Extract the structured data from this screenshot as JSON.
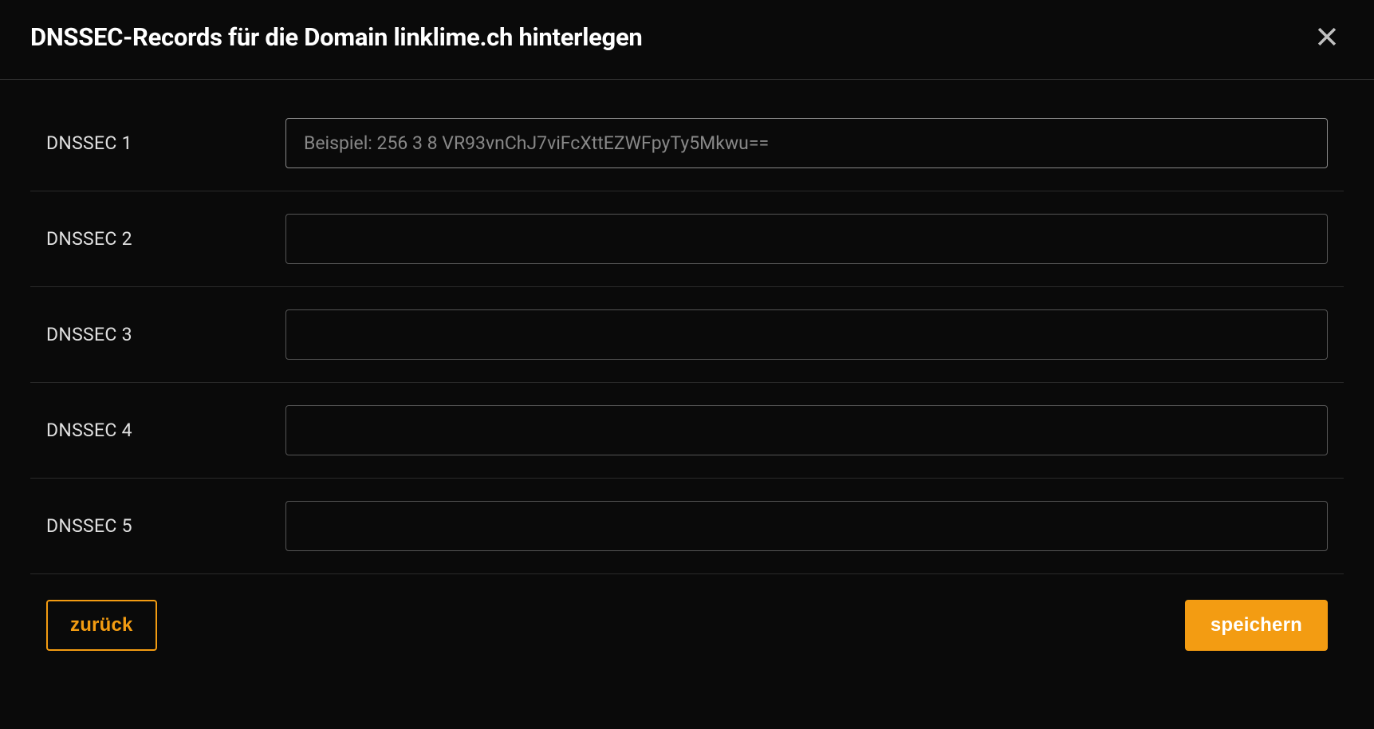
{
  "header": {
    "title": "DNSSEC-Records für die Domain linklime.ch hinterlegen"
  },
  "fields": [
    {
      "label": "DNSSEC 1",
      "placeholder": "Beispiel: 256 3 8 VR93vnChJ7viFcXttEZWFpyTy5Mkwu==",
      "value": ""
    },
    {
      "label": "DNSSEC 2",
      "placeholder": "",
      "value": ""
    },
    {
      "label": "DNSSEC 3",
      "placeholder": "",
      "value": ""
    },
    {
      "label": "DNSSEC 4",
      "placeholder": "",
      "value": ""
    },
    {
      "label": "DNSSEC 5",
      "placeholder": "",
      "value": ""
    }
  ],
  "footer": {
    "back_label": "zurück",
    "save_label": "speichern"
  }
}
